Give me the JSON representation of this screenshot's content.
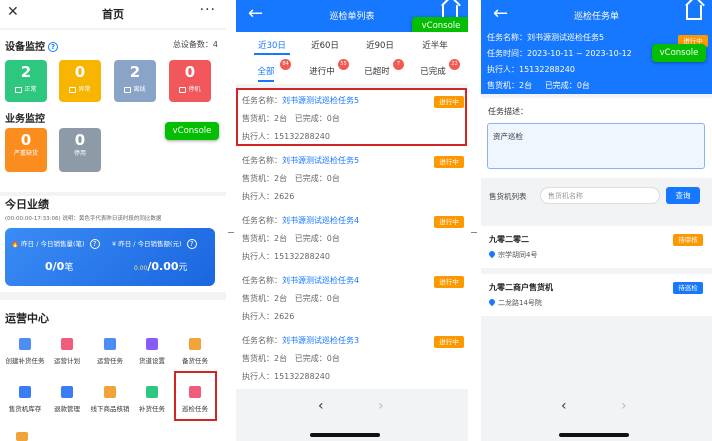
{
  "panel1": {
    "header": {
      "title": "首页",
      "more": "···",
      "close": "✕"
    },
    "device_monitor": {
      "title": "设备监控",
      "total_label": "总设备数：",
      "total": "4",
      "tiles": [
        {
          "value": "2",
          "label": "正常",
          "color": "#2ec77f"
        },
        {
          "value": "0",
          "label": "异常",
          "color": "#f7b500"
        },
        {
          "value": "2",
          "label": "离线",
          "color": "#8aa4c8"
        },
        {
          "value": "0",
          "label": "停机",
          "color": "#f2575c"
        }
      ]
    },
    "business_monitor": {
      "title": "业务监控",
      "tiles": [
        {
          "value": "0",
          "label": "严重缺货",
          "color": "#fb8c1e"
        },
        {
          "value": "0",
          "label": "停用",
          "color": "#8e9aa8"
        }
      ]
    },
    "vconsole": "vConsole",
    "today": {
      "title": "今日业绩",
      "note": "(00:00:00-17:33:06)   说明：黄色字代表昨日该时段的同比数据",
      "sales_count_label": "昨日 / 今日销售量(笔)",
      "sales_count_value": "0/0",
      "sales_count_unit": "笔",
      "sales_amount_label": "昨日 / 今日销售额(元)",
      "sales_amount_prefix": "0.00",
      "sales_amount_value": "/0.00",
      "sales_amount_unit": "元"
    },
    "ops_center": {
      "title": "运营中心",
      "items": [
        {
          "label": "创建补货任务",
          "color": "#4c8cf5"
        },
        {
          "label": "运营计划",
          "color": "#f25c7c"
        },
        {
          "label": "运营任务",
          "color": "#4c8cf5"
        },
        {
          "label": "货道设置",
          "color": "#8a5cf5"
        },
        {
          "label": "备货任务",
          "color": "#f2a33a"
        },
        {
          "label": "售货机库存",
          "color": "#3a7cf5"
        },
        {
          "label": "退款管理",
          "color": "#3a7cf5"
        },
        {
          "label": "线下商品核销",
          "color": "#f2a33a"
        },
        {
          "label": "补货任务",
          "color": "#2ec77f"
        },
        {
          "label": "巡检任务",
          "color": "#f25c7c"
        }
      ]
    }
  },
  "panel2": {
    "header": {
      "title": "巡检单列表",
      "back": "←"
    },
    "vconsole": "vConsole",
    "range_tabs": [
      "近30日",
      "近60日",
      "近90日",
      "近半年"
    ],
    "status_tabs": [
      {
        "label": "全部",
        "badge": "84"
      },
      {
        "label": "进行中",
        "badge": "55"
      },
      {
        "label": "已超时",
        "badge": "7"
      },
      {
        "label": "已完成",
        "badge": "22"
      }
    ],
    "tasks": [
      {
        "name_label": "任务名称：",
        "name": "刘书源测试巡检任务5",
        "status": "进行中",
        "machines_label": "售货机：",
        "machines": "2台",
        "done_label": "已完成：",
        "done": "0台",
        "executor_label": "执行人：",
        "executor": "15132288240"
      },
      {
        "name_label": "任务名称：",
        "name": "刘书源测试巡检任务5",
        "status": "进行中",
        "machines_label": "售货机：",
        "machines": "2台",
        "done_label": "已完成：",
        "done": "0台",
        "executor_label": "执行人：",
        "executor": "2626"
      },
      {
        "name_label": "任务名称：",
        "name": "刘书源测试巡检任务4",
        "status": "进行中",
        "machines_label": "售货机：",
        "machines": "2台",
        "done_label": "已完成：",
        "done": "0台",
        "executor_label": "执行人：",
        "executor": "15132288240"
      },
      {
        "name_label": "任务名称：",
        "name": "刘书源测试巡检任务4",
        "status": "进行中",
        "machines_label": "售货机：",
        "machines": "2台",
        "done_label": "已完成：",
        "done": "0台",
        "executor_label": "执行人：",
        "executor": "2626"
      },
      {
        "name_label": "任务名称：",
        "name": "刘书源测试巡检任务3",
        "status": "进行中",
        "machines_label": "售货机：",
        "machines": "2台",
        "done_label": "已完成：",
        "done": "0台",
        "executor_label": "执行人：",
        "executor": "15132288240"
      }
    ],
    "nav": {
      "prev": "‹",
      "next": "›"
    }
  },
  "panel3": {
    "header": {
      "title": "巡检任务单",
      "back": "←"
    },
    "vconsole": "vConsole",
    "info": {
      "name_label": "任务名称：",
      "name": "刘书源测试巡检任务5",
      "status": "进行中",
      "time_label": "任务时间：",
      "time": "2023-10-11 ~ 2023-10-12",
      "executor_label": "执行人：",
      "executor": "15132288240",
      "machines_label": "售货机：",
      "machines": "2台",
      "done_label": "已完成：",
      "done": "0台"
    },
    "desc_label": "任务描述：",
    "desc": "资产巡检",
    "search": {
      "label": "售货机列表",
      "placeholder": "售货机名称",
      "button": "查询"
    },
    "machines": [
      {
        "name": "九零二零二",
        "address": "宗学胡同4号",
        "tag": "待审核",
        "tag_color": "#fe9800"
      },
      {
        "name": "九零二商户售货机",
        "address": "二龙路14号院",
        "tag": "待巡检",
        "tag_color": "#1677ff"
      }
    ],
    "nav": {
      "prev": "‹",
      "next": "›"
    }
  }
}
